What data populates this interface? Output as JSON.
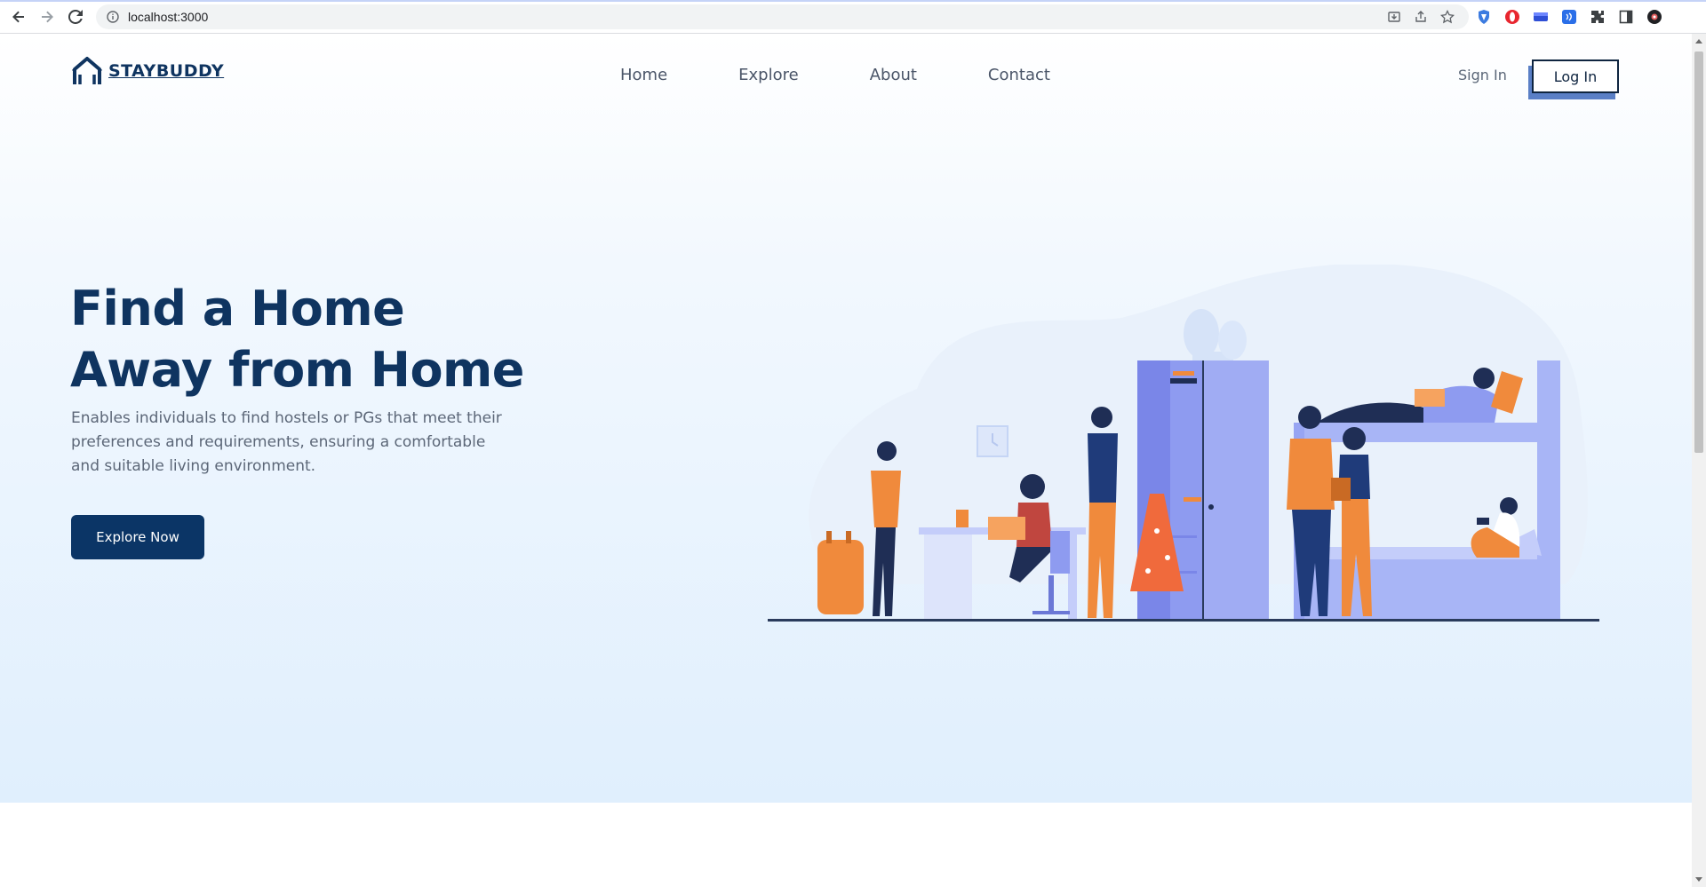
{
  "browser": {
    "url": "localhost:3000",
    "icons": [
      "back-icon",
      "forward-icon",
      "reload-icon",
      "info-icon",
      "install-icon",
      "share-icon",
      "star-icon",
      "shield-extension-icon",
      "opera-extension-icon",
      "extension-icon",
      "extension-icon",
      "puzzle-icon",
      "sidepanel-icon",
      "profile-icon"
    ]
  },
  "navbar": {
    "brand": "STAYBUDDY",
    "links": [
      "Home",
      "Explore",
      "About",
      "Contact"
    ],
    "sign_in": "Sign In",
    "log_in": "Log In"
  },
  "hero": {
    "title_line1": "Find a Home",
    "title_line2": "Away from Home",
    "description": "Enables individuals to find hostels or PGs that meet their preferences and requirements, ensuring a comfortable and suitable living environment.",
    "cta": "Explore Now"
  },
  "colors": {
    "brand": "#0f3460",
    "cta": "#0b3566",
    "accent_orange": "#f08a3c",
    "accent_purple": "#8e9bf0"
  }
}
